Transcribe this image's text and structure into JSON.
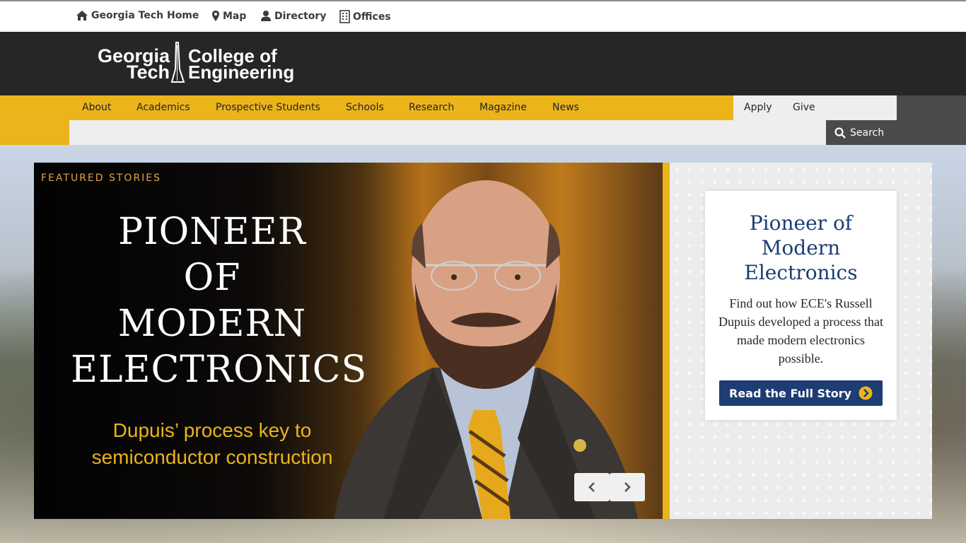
{
  "utility": {
    "home": "Georgia Tech Home",
    "map": "Map",
    "directory": "Directory",
    "offices": "Offices"
  },
  "brand": {
    "logo_left_1": "Georgia",
    "logo_left_2": "Tech",
    "logo_right_1": "College of",
    "logo_right_2": "Engineering"
  },
  "nav": {
    "items": [
      "About",
      "Academics",
      "Prospective Students",
      "Schools",
      "Research",
      "Magazine",
      "News"
    ],
    "apply": "Apply",
    "give": "Give",
    "search": "Search"
  },
  "slide": {
    "label": "FEATURED STORIES",
    "headline_1": "PIONEER",
    "headline_2": "OF",
    "headline_3": "MODERN",
    "headline_4": "ELECTRONICS",
    "subhead_1": "Dupuis’ process key to",
    "subhead_2": "semiconductor construction"
  },
  "card": {
    "title_1": "Pioneer of",
    "title_2": "Modern",
    "title_3": "Electronics",
    "text": "Find out how ECE's Russell Dupuis developed a process that made modern electronics possible.",
    "button": "Read the Full Story"
  },
  "colors": {
    "gold": "#eab41a",
    "navy": "#1d3d73",
    "dark": "#262626"
  }
}
